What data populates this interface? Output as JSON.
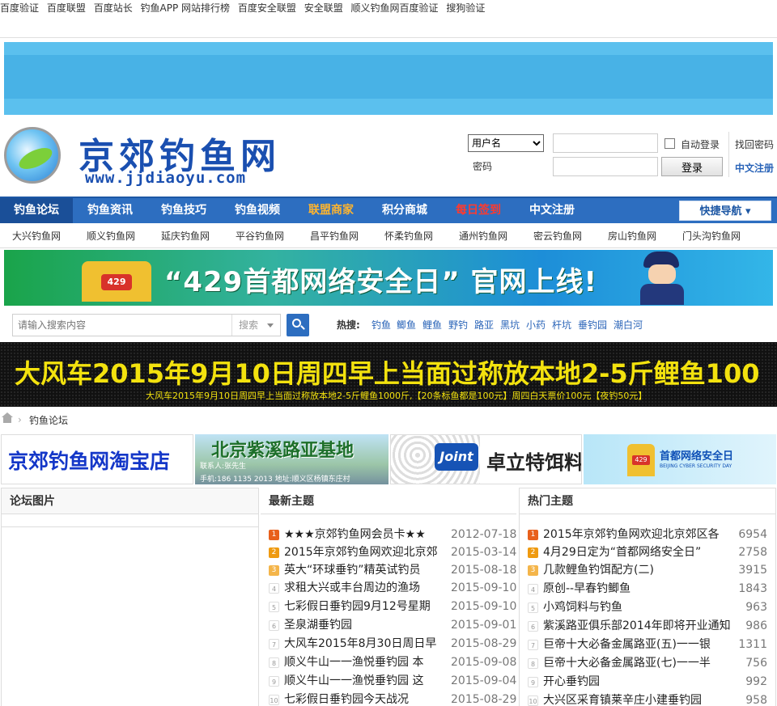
{
  "top_links": [
    "百度验证",
    "百度联盟",
    "百度站长",
    "钓鱼APP 网站排行榜",
    "百度安全联盟",
    "安全联盟",
    "顺义钓鱼网百度验证",
    "搜狗验证"
  ],
  "logo": {
    "title": "京郊钓鱼网",
    "url": "www.jjdiaoyu.com"
  },
  "login": {
    "username_select": "用户名",
    "password_label": "密码",
    "auto_login": "自动登录",
    "login_button": "登录",
    "forgot": "找回密码",
    "register": "中文注册"
  },
  "nav": {
    "items": [
      {
        "label": "钓鱼论坛",
        "color": "#ffffff"
      },
      {
        "label": "钓鱼资讯",
        "color": "#ffffff"
      },
      {
        "label": "钓鱼技巧",
        "color": "#ffffff"
      },
      {
        "label": "钓鱼视频",
        "color": "#ffffff"
      },
      {
        "label": "联盟商家",
        "color": "#ffb52e"
      },
      {
        "label": "积分商城",
        "color": "#ffffff"
      },
      {
        "label": "每日签到",
        "color": "#ff3a2e"
      },
      {
        "label": "中文注册",
        "color": "#ffffff"
      }
    ],
    "quick_nav": "快捷导航 ▾"
  },
  "subnav": [
    "大兴钓鱼网",
    "顺义钓鱼网",
    "延庆钓鱼网",
    "平谷钓鱼网",
    "昌平钓鱼网",
    "怀柔钓鱼网",
    "通州钓鱼网",
    "密云钓鱼网",
    "房山钓鱼网",
    "门头沟钓鱼网"
  ],
  "banner_429": {
    "badge": "429",
    "text": "“429首都网络安全日” 官网上线!"
  },
  "search": {
    "placeholder": "请输入搜索内容",
    "type": "搜索",
    "hot_label": "热搜:",
    "hot_words": [
      "钓鱼",
      "鲫鱼",
      "鲤鱼",
      "野钓",
      "路亚",
      "黑坑",
      "小药",
      "杆坑",
      "垂钓园",
      "潮白河"
    ]
  },
  "marquee": {
    "big": "大风车2015年9月10日周四早上当面过称放本地2-5斤鲤鱼100",
    "small": "大风车2015年9月10日周四早上当面过称放本地2-5斤鲤鱼1000斤,【20条标鱼都是100元】周四白天票价100元【夜钓50元】"
  },
  "breadcrumb": {
    "current": "钓鱼论坛"
  },
  "ads": {
    "taobao": "京郊钓鱼网淘宝店",
    "ziyue": {
      "title": "北京紫溪路亚基地",
      "contact": "联系人:张先生",
      "phone": "手机:186 1135 2013    地址:顺义区杨镇东庄村"
    },
    "joint": {
      "logo": "Joint",
      "title": "卓立特饵料"
    },
    "cyber": {
      "badge": "429",
      "title": "首都网络安全日",
      "sub": "BEIJING CYBER SECURITY DAY"
    }
  },
  "panels": {
    "pics": {
      "title": "论坛图片"
    },
    "latest": {
      "title": "最新主题",
      "rows": [
        {
          "n": "1",
          "title": "★★★京郊钓鱼网会员卡★★",
          "date": "2012-07-18"
        },
        {
          "n": "2",
          "title": "2015年京郊钓鱼网欢迎北京郊",
          "date": "2015-03-14"
        },
        {
          "n": "3",
          "title": "英大“环球垂钓”精英试钓员",
          "date": "2015-08-18"
        },
        {
          "n": "4",
          "title": "求租大兴或丰台周边的渔场",
          "date": "2015-09-10"
        },
        {
          "n": "5",
          "title": "七彩假日垂钓园9月12号星期",
          "date": "2015-09-10"
        },
        {
          "n": "6",
          "title": "圣泉湖垂钓园",
          "date": "2015-09-01"
        },
        {
          "n": "7",
          "title": "大风车2015年8月30日周日早",
          "date": "2015-08-29"
        },
        {
          "n": "8",
          "title": "顺义牛山一一渔悦垂钓园 本",
          "date": "2015-09-08"
        },
        {
          "n": "9",
          "title": "顺义牛山一一渔悦垂钓园 这",
          "date": "2015-09-04"
        },
        {
          "n": "10",
          "title": "七彩假日垂钓园今天战况",
          "date": "2015-08-29"
        }
      ]
    },
    "hot": {
      "title": "热门主题",
      "rows": [
        {
          "n": "1",
          "title": "2015年京郊钓鱼网欢迎北京郊区各",
          "count": "6954"
        },
        {
          "n": "2",
          "title": "4月29日定为“首都网络安全日”",
          "count": "2758"
        },
        {
          "n": "3",
          "title": "几款鲤鱼钓饵配方(二)",
          "count": "3915"
        },
        {
          "n": "4",
          "title": "原创--早春钓鲫鱼",
          "count": "1843"
        },
        {
          "n": "5",
          "title": "小鸡饲料与钓鱼",
          "count": "963"
        },
        {
          "n": "6",
          "title": "紫溪路亚俱乐部2014年即将开业通知",
          "count": "986"
        },
        {
          "n": "7",
          "title": "巨帝十大必备金属路亚(五)一一银",
          "count": "1311"
        },
        {
          "n": "8",
          "title": "巨帝十大必备金属路亚(七)一一半",
          "count": "756"
        },
        {
          "n": "9",
          "title": "开心垂钓园",
          "count": "992"
        },
        {
          "n": "10",
          "title": "大兴区采育镇莱辛庄小建垂钓园",
          "count": "958"
        }
      ]
    }
  }
}
